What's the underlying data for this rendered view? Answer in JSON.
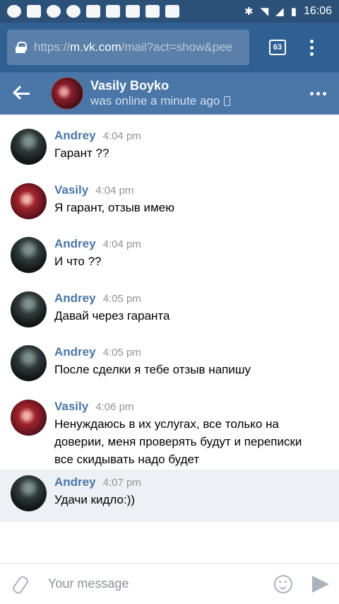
{
  "status_bar": {
    "time": "16:06",
    "icons": [
      "notification-icon",
      "sms-icon",
      "quora-icon",
      "at-icon",
      "mail-icon",
      "mail-icon",
      "gallery-icon",
      "youtube-icon",
      "youtube-icon",
      "bluetooth-icon",
      "wifi-icon",
      "signal-icon",
      "battery-icon"
    ]
  },
  "browser": {
    "url_scheme": "https://",
    "url_host": "m.vk.com",
    "url_rest": "/mail?act=show&pee",
    "tab_count": "63"
  },
  "header": {
    "name": "Vasily Boyko",
    "status": "was online a minute ago"
  },
  "messages": [
    {
      "author": "Andrey",
      "time": "4:04 pm",
      "text": "Гарант ??",
      "avatar": "andrey",
      "highlight": false
    },
    {
      "author": "Vasily",
      "time": "4:04 pm",
      "text": "Я гарант, отзыв имею",
      "avatar": "vasily",
      "highlight": false
    },
    {
      "author": "Andrey",
      "time": "4:04 pm",
      "text": "И что ??",
      "avatar": "andrey",
      "highlight": false
    },
    {
      "author": "Andrey",
      "time": "4:05 pm",
      "text": "Давай через гаранта",
      "avatar": "andrey",
      "highlight": false
    },
    {
      "author": "Andrey",
      "time": "4:05 pm",
      "text": "После сделки я тебе отзыв напишу",
      "avatar": "andrey",
      "highlight": false
    },
    {
      "author": "Vasily",
      "time": "4:06 pm",
      "text": "Ненуждаюсь в их услугах, все только на доверии, меня проверять будут и переписки все скидывать надо будет",
      "avatar": "vasily",
      "highlight": false
    },
    {
      "author": "Andrey",
      "time": "4:07 pm",
      "text": "Удачи кидло:))",
      "avatar": "andrey",
      "highlight": true
    }
  ],
  "composer": {
    "placeholder": "Your message"
  },
  "colors": {
    "status_bar": "#2b5178",
    "browser_bar": "#2f5f93",
    "vk_header": "#4a76a8",
    "author": "#4a76a8",
    "highlight_row": "#edf0f5"
  }
}
